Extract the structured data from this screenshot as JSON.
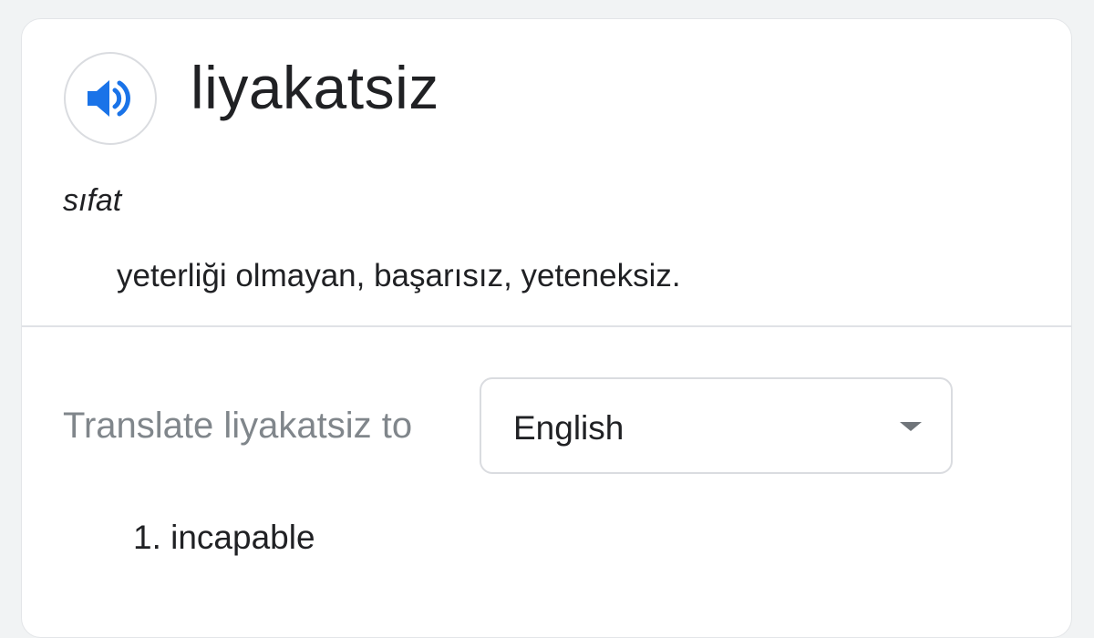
{
  "entry": {
    "headword": "liyakatsiz",
    "part_of_speech": "sıfat",
    "definition": "yeterliği olmayan, başarısız, yeteneksiz.",
    "audio_icon": "speaker-icon"
  },
  "translate": {
    "label": "Translate liyakatsiz to",
    "selected_language": "English",
    "results": [
      "1. incapable"
    ]
  },
  "colors": {
    "accent": "#1a73e8",
    "text": "#202124",
    "muted": "#80868b",
    "border": "#dadce0"
  }
}
